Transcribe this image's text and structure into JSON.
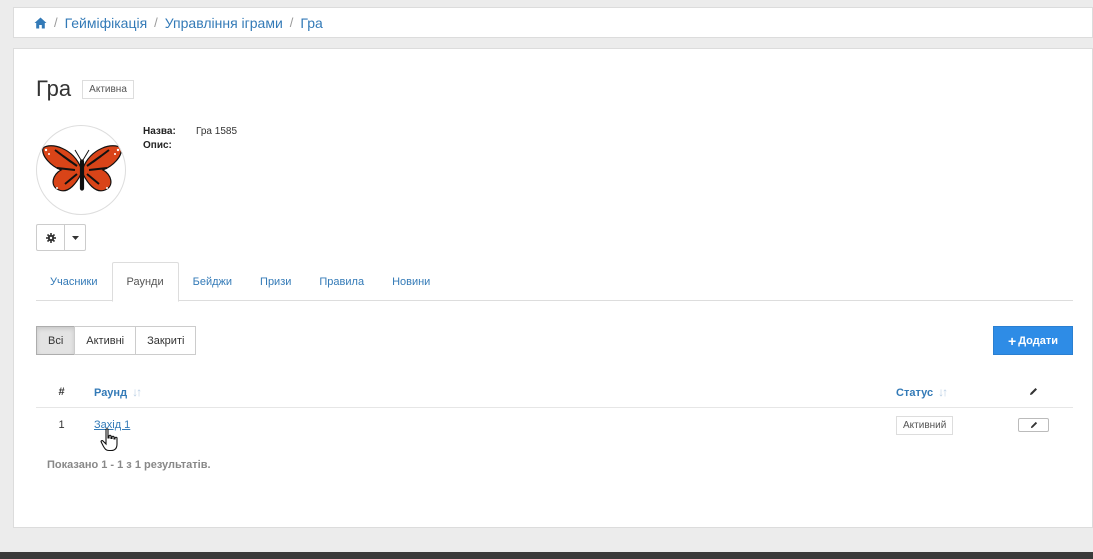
{
  "breadcrumb": {
    "items": [
      "Гейміфікація",
      "Управління іграми",
      "Гра"
    ],
    "separator": "/"
  },
  "game": {
    "title": "Гра",
    "status": "Активна",
    "name_label": "Назва:",
    "name_value": "Гра 1585",
    "description_label": "Опис:",
    "description_value": ""
  },
  "tabs": [
    "Учасники",
    "Раунди",
    "Бейджи",
    "Призи",
    "Правила",
    "Новини"
  ],
  "active_tab": "Раунди",
  "filters": [
    "Всі",
    "Активні",
    "Закриті"
  ],
  "active_filter": "Всі",
  "add_button": {
    "label": "Додати"
  },
  "table": {
    "headers": {
      "num": "#",
      "round": "Раунд",
      "status": "Статус"
    },
    "rows": [
      {
        "num": "1",
        "round": "Захід 1",
        "status": "Активний"
      }
    ]
  },
  "summary": "Показано 1 - 1 з 1 результатів.",
  "colors": {
    "accent": "#337ab7",
    "primary_button": "#2e8ce6"
  }
}
